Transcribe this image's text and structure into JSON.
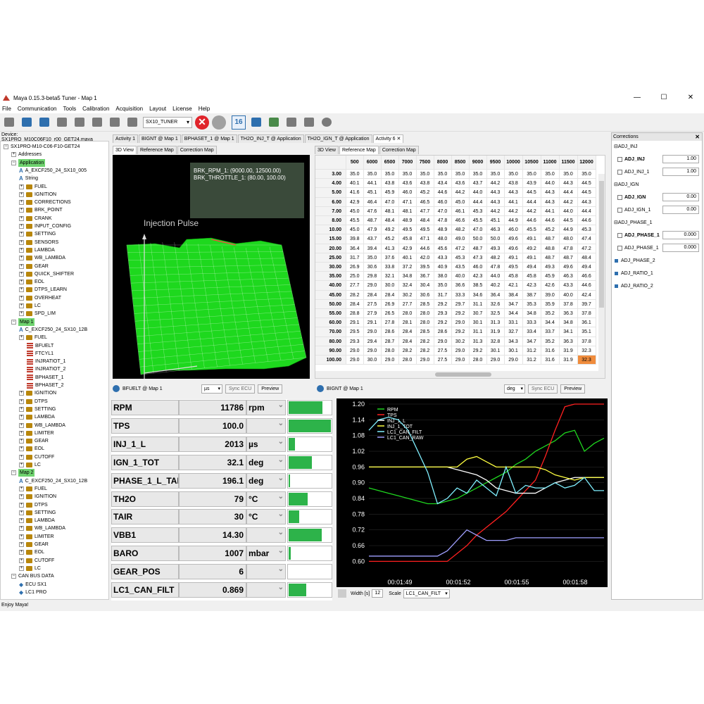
{
  "window": {
    "title": "Maya 0.15.3-beta5 Tuner - Map 1",
    "minimize": "—",
    "maximize": "☐",
    "close": "✕"
  },
  "menu": [
    "File",
    "Communication",
    "Tools",
    "Calibration",
    "Acquisition",
    "Layout",
    "License",
    "Help"
  ],
  "toolbar": {
    "tuner_select": "SX10_TUNER",
    "stop": "✕",
    "calendar_num": "16"
  },
  "device": "Device: SX1PRO_M10C06F10_r00_GET24.maya",
  "tree": [
    {
      "label": "SX1PRO-M10-C06-F10-GET24",
      "indent": 0,
      "kind": "exp",
      "exp": "−"
    },
    {
      "label": "Addresses",
      "indent": 1,
      "kind": "exp",
      "exp": "+"
    },
    {
      "label": "Application",
      "indent": 1,
      "kind": "exp",
      "exp": "−",
      "hl": true
    },
    {
      "label": "A_EXCF250_24_SX10_005",
      "indent": 2,
      "kind": "a"
    },
    {
      "label": "String",
      "indent": 2,
      "kind": "a"
    },
    {
      "label": "FUEL",
      "indent": 2,
      "kind": "f"
    },
    {
      "label": "IGNITION",
      "indent": 2,
      "kind": "f"
    },
    {
      "label": "CORRECTIONS",
      "indent": 2,
      "kind": "f"
    },
    {
      "label": "BRK_POINT",
      "indent": 2,
      "kind": "f"
    },
    {
      "label": "CRANK",
      "indent": 2,
      "kind": "f"
    },
    {
      "label": "INPUT_CONFIG",
      "indent": 2,
      "kind": "f"
    },
    {
      "label": "SETTING",
      "indent": 2,
      "kind": "f"
    },
    {
      "label": "SENSORS",
      "indent": 2,
      "kind": "f"
    },
    {
      "label": "LAMBDA",
      "indent": 2,
      "kind": "f"
    },
    {
      "label": "WB_LAMBDA",
      "indent": 2,
      "kind": "f"
    },
    {
      "label": "GEAR",
      "indent": 2,
      "kind": "f"
    },
    {
      "label": "QUICK_SHIFTER",
      "indent": 2,
      "kind": "f"
    },
    {
      "label": "EOL",
      "indent": 2,
      "kind": "f"
    },
    {
      "label": "DTPS_LEARN",
      "indent": 2,
      "kind": "f"
    },
    {
      "label": "OVERHEAT",
      "indent": 2,
      "kind": "f"
    },
    {
      "label": "LC",
      "indent": 2,
      "kind": "f"
    },
    {
      "label": "SPD_LIM",
      "indent": 2,
      "kind": "f"
    },
    {
      "label": "Map 1",
      "indent": 1,
      "kind": "exp",
      "exp": "−",
      "hl": true
    },
    {
      "label": "C_EXCF250_24_SX10_12B",
      "indent": 2,
      "kind": "a"
    },
    {
      "label": "FUEL",
      "indent": 2,
      "kind": "f"
    },
    {
      "label": "BFUELT",
      "indent": 3,
      "kind": "t"
    },
    {
      "label": "FTCYL1",
      "indent": 3,
      "kind": "t"
    },
    {
      "label": "INJRATIOT_1",
      "indent": 3,
      "kind": "t"
    },
    {
      "label": "INJRATIOT_2",
      "indent": 3,
      "kind": "t"
    },
    {
      "label": "BPHASET_1",
      "indent": 3,
      "kind": "t"
    },
    {
      "label": "BPHASET_2",
      "indent": 3,
      "kind": "t"
    },
    {
      "label": "IGNITION",
      "indent": 2,
      "kind": "f"
    },
    {
      "label": "DTPS",
      "indent": 2,
      "kind": "f"
    },
    {
      "label": "SETTING",
      "indent": 2,
      "kind": "f"
    },
    {
      "label": "LAMBDA",
      "indent": 2,
      "kind": "f"
    },
    {
      "label": "WB_LAMBDA",
      "indent": 2,
      "kind": "f"
    },
    {
      "label": "LIMITER",
      "indent": 2,
      "kind": "f"
    },
    {
      "label": "GEAR",
      "indent": 2,
      "kind": "f"
    },
    {
      "label": "EOL",
      "indent": 2,
      "kind": "f"
    },
    {
      "label": "CUTOFF",
      "indent": 2,
      "kind": "f"
    },
    {
      "label": "LC",
      "indent": 2,
      "kind": "f"
    },
    {
      "label": "Map 2",
      "indent": 1,
      "kind": "exp",
      "exp": "−",
      "hl": true
    },
    {
      "label": "C_EXCF250_24_SX10_12B",
      "indent": 2,
      "kind": "a"
    },
    {
      "label": "FUEL",
      "indent": 2,
      "kind": "f"
    },
    {
      "label": "IGNITION",
      "indent": 2,
      "kind": "f"
    },
    {
      "label": "DTPS",
      "indent": 2,
      "kind": "f"
    },
    {
      "label": "SETTING",
      "indent": 2,
      "kind": "f"
    },
    {
      "label": "LAMBDA",
      "indent": 2,
      "kind": "f"
    },
    {
      "label": "WB_LAMBDA",
      "indent": 2,
      "kind": "f"
    },
    {
      "label": "LIMITER",
      "indent": 2,
      "kind": "f"
    },
    {
      "label": "GEAR",
      "indent": 2,
      "kind": "f"
    },
    {
      "label": "EOL",
      "indent": 2,
      "kind": "f"
    },
    {
      "label": "CUTOFF",
      "indent": 2,
      "kind": "f"
    },
    {
      "label": "LC",
      "indent": 2,
      "kind": "f"
    },
    {
      "label": "CAN BUS DATA",
      "indent": 1,
      "kind": "exp",
      "exp": "−"
    },
    {
      "label": "ECU SX1",
      "indent": 2,
      "kind": "b"
    },
    {
      "label": "LC1 PRO",
      "indent": 2,
      "kind": "b"
    }
  ],
  "main_tabs": [
    "Activity 1",
    "BIGNT @ Map 1",
    "BPHASET_1 @ Map 1",
    "TH2O_INJ_T @ Application",
    "TH2O_IGN_T @ Application",
    "Activity 6"
  ],
  "main_tab_close": "✕",
  "left_view_tabs": [
    "3D View",
    "Reference Map",
    "Correction Map"
  ],
  "right_view_tabs": [
    "3D View",
    "Reference Map",
    "Correction Map"
  ],
  "view3d": {
    "title": "Injection Pulse",
    "info_line1": "BRK_RPM_1: (9000.00, 12500.00)",
    "info_line2": "BRK_THROTTLE_1: (80.00, 100.00)",
    "surface_color": "#1ed81e"
  },
  "map_table": {
    "cols": [
      "500",
      "6000",
      "6500",
      "7000",
      "7500",
      "8000",
      "8500",
      "9000",
      "9500",
      "10000",
      "10500",
      "11000",
      "11500",
      "12000"
    ],
    "rows": [
      "3.00",
      "4.00",
      "5.00",
      "6.00",
      "7.00",
      "8.00",
      "10.00",
      "15.00",
      "20.00",
      "25.00",
      "30.00",
      "35.00",
      "40.00",
      "45.00",
      "50.00",
      "55.00",
      "60.00",
      "70.00",
      "80.00",
      "90.00",
      "100.00"
    ],
    "values": [
      [
        "35.0",
        "35.0",
        "35.0",
        "35.0",
        "35.0",
        "35.0",
        "35.0",
        "35.0",
        "35.0",
        "35.0",
        "35.0",
        "35.0",
        "35.0",
        "35.0"
      ],
      [
        "40.1",
        "44.1",
        "43.8",
        "43.6",
        "43.8",
        "43.4",
        "43.6",
        "43.7",
        "44.2",
        "43.8",
        "43.9",
        "44.0",
        "44.3",
        "44.5"
      ],
      [
        "41.6",
        "45.1",
        "45.9",
        "46.0",
        "45.2",
        "44.6",
        "44.2",
        "44.0",
        "44.3",
        "44.3",
        "44.5",
        "44.3",
        "44.4",
        "44.5"
      ],
      [
        "42.9",
        "46.4",
        "47.0",
        "47.1",
        "46.5",
        "46.0",
        "45.0",
        "44.4",
        "44.3",
        "44.1",
        "44.4",
        "44.3",
        "44.2",
        "44.3"
      ],
      [
        "45.0",
        "47.6",
        "48.1",
        "48.1",
        "47.7",
        "47.0",
        "46.1",
        "45.3",
        "44.2",
        "44.2",
        "44.2",
        "44.1",
        "44.0",
        "44.4"
      ],
      [
        "45.5",
        "48.7",
        "48.4",
        "48.9",
        "48.4",
        "47.8",
        "46.6",
        "45.5",
        "45.1",
        "44.9",
        "44.6",
        "44.6",
        "44.5",
        "44.6"
      ],
      [
        "45.0",
        "47.9",
        "49.2",
        "49.5",
        "49.5",
        "48.9",
        "48.2",
        "47.0",
        "46.3",
        "46.0",
        "45.5",
        "45.2",
        "44.9",
        "45.3"
      ],
      [
        "39.8",
        "43.7",
        "45.2",
        "45.8",
        "47.1",
        "48.0",
        "49.0",
        "50.0",
        "50.0",
        "49.6",
        "49.1",
        "48.7",
        "48.0",
        "47.4"
      ],
      [
        "36.4",
        "39.4",
        "41.3",
        "42.9",
        "44.6",
        "45.6",
        "47.2",
        "48.7",
        "49.3",
        "49.6",
        "49.2",
        "48.8",
        "47.8",
        "47.2"
      ],
      [
        "31.7",
        "35.0",
        "37.6",
        "40.1",
        "42.0",
        "43.3",
        "45.3",
        "47.3",
        "48.2",
        "49.1",
        "49.1",
        "48.7",
        "48.7",
        "48.4"
      ],
      [
        "26.9",
        "30.6",
        "33.8",
        "37.2",
        "39.5",
        "40.9",
        "43.5",
        "46.0",
        "47.8",
        "49.5",
        "49.4",
        "49.3",
        "49.6",
        "49.4"
      ],
      [
        "25.0",
        "29.8",
        "32.1",
        "34.8",
        "36.7",
        "38.0",
        "40.0",
        "42.3",
        "44.0",
        "45.8",
        "45.8",
        "45.9",
        "46.3",
        "46.6"
      ],
      [
        "27.7",
        "29.0",
        "30.0",
        "32.4",
        "30.4",
        "35.0",
        "36.6",
        "38.5",
        "40.2",
        "42.1",
        "42.3",
        "42.6",
        "43.3",
        "44.6"
      ],
      [
        "28.2",
        "28.4",
        "28.4",
        "30.2",
        "30.6",
        "31.7",
        "33.3",
        "34.6",
        "36.4",
        "38.4",
        "38.7",
        "39.0",
        "40.0",
        "42.4"
      ],
      [
        "28.4",
        "27.5",
        "26.9",
        "27.7",
        "28.5",
        "29.2",
        "29.7",
        "31.1",
        "32.6",
        "34.7",
        "35.3",
        "35.9",
        "37.8",
        "39.7"
      ],
      [
        "28.8",
        "27.9",
        "26.5",
        "28.0",
        "28.0",
        "29.3",
        "29.2",
        "30.7",
        "32.5",
        "34.4",
        "34.8",
        "35.2",
        "36.3",
        "37.8"
      ],
      [
        "29.1",
        "29.1",
        "27.8",
        "28.1",
        "28.0",
        "29.2",
        "29.0",
        "30.1",
        "31.3",
        "33.1",
        "33.3",
        "34.4",
        "34.8",
        "36.1"
      ],
      [
        "29.5",
        "29.0",
        "28.6",
        "28.4",
        "28.5",
        "28.6",
        "29.2",
        "31.1",
        "31.9",
        "32.7",
        "33.4",
        "33.7",
        "34.1",
        "35.1"
      ],
      [
        "29.3",
        "29.4",
        "28.7",
        "28.4",
        "28.2",
        "29.0",
        "30.2",
        "31.3",
        "32.8",
        "34.3",
        "34.7",
        "35.2",
        "36.3",
        "37.8"
      ],
      [
        "29.0",
        "29.0",
        "28.0",
        "28.2",
        "28.2",
        "27.5",
        "29.0",
        "29.2",
        "30.1",
        "30.1",
        "31.2",
        "31.6",
        "31.9",
        "32.3"
      ],
      [
        "29.0",
        "30.0",
        "29.0",
        "28.0",
        "29.0",
        "27.5",
        "29.0",
        "28.0",
        "29.0",
        "29.0",
        "31.2",
        "31.6",
        "31.9",
        "32.3"
      ]
    ],
    "highlight_color": "#f08c3c"
  },
  "left_panel": {
    "title": "BFUELT @ Map 1",
    "unit_select": "µs",
    "sync": "Sync ECU",
    "preview": "Preview"
  },
  "right_panel": {
    "title": "BIGNT @ Map 1",
    "unit_select": "deg",
    "sync": "Sync ECU",
    "preview": "Preview"
  },
  "dashboard": [
    {
      "name": "RPM",
      "value": "11786",
      "unit": "rpm",
      "level": 0.8
    },
    {
      "name": "TPS",
      "value": "100.0",
      "unit": "",
      "level": 1.0
    },
    {
      "name": "INJ_1_L",
      "value": "2013",
      "unit": "µs",
      "level": 0.15
    },
    {
      "name": "IGN_1_TOT",
      "value": "32.1",
      "unit": "deg",
      "level": 0.55
    },
    {
      "name": "PHASE_1_L_TAB",
      "value": "196.1",
      "unit": "deg",
      "level": 0.03
    },
    {
      "name": "TH2O",
      "value": "79",
      "unit": "°C",
      "level": 0.45
    },
    {
      "name": "TAIR",
      "value": "30",
      "unit": "°C",
      "level": 0.25
    },
    {
      "name": "VBB1",
      "value": "14.30",
      "unit": "",
      "level": 0.78
    },
    {
      "name": "BARO",
      "value": "1007",
      "unit": "mbar",
      "level": 0.05
    },
    {
      "name": "GEAR_POS",
      "value": "6",
      "unit": "",
      "level": 0.0
    },
    {
      "name": "LC1_CAN_FILT",
      "value": "0.869",
      "unit": "",
      "level": 0.42
    }
  ],
  "bar_color": "#2db34a",
  "chart_data": {
    "type": "line",
    "ylim": [
      0.55,
      1.2
    ],
    "yticks": [
      "1.20",
      "1.14",
      "1.08",
      "1.02",
      "0.96",
      "0.90",
      "0.84",
      "0.78",
      "0.72",
      "0.66",
      "0.60"
    ],
    "xticks": [
      "00:01:49",
      "00:01:52",
      "00:01:55",
      "00:01:58"
    ],
    "x": [
      0,
      0.5,
      1,
      1.5,
      2,
      2.5,
      3,
      3.5,
      4,
      4.5,
      5,
      5.5,
      6,
      6.5,
      7,
      7.5,
      8,
      8.5,
      9,
      9.5,
      10,
      10.5,
      11,
      11.5,
      12
    ],
    "series": [
      {
        "name": "RPM",
        "color": "#1fd61f",
        "values": [
          0.88,
          0.87,
          0.86,
          0.85,
          0.84,
          0.83,
          0.82,
          0.82,
          0.83,
          0.84,
          0.86,
          0.88,
          0.9,
          0.92,
          0.94,
          0.97,
          0.99,
          1.02,
          1.04,
          1.06,
          1.09,
          1.1,
          1.02,
          1.05,
          1.07
        ]
      },
      {
        "name": "TPS",
        "color": "#ff2020",
        "values": [
          0.6,
          0.6,
          0.6,
          0.6,
          0.6,
          0.6,
          0.6,
          0.6,
          0.6,
          0.63,
          0.66,
          0.7,
          0.73,
          0.76,
          0.79,
          0.83,
          0.87,
          0.91,
          1.0,
          1.1,
          1.19,
          1.2,
          1.2,
          1.2,
          1.2
        ]
      },
      {
        "name": "INJ_1_L",
        "color": "#ffffff",
        "values": [
          0.96,
          0.96,
          0.96,
          0.96,
          0.96,
          0.96,
          0.96,
          0.96,
          0.96,
          0.95,
          0.94,
          0.93,
          0.91,
          0.88,
          0.87,
          0.86,
          0.86,
          0.86,
          0.88,
          0.9,
          0.91,
          0.92,
          0.92,
          0.92,
          0.92
        ]
      },
      {
        "name": "INJ_1_TOT",
        "color": "#ffff40",
        "values": [
          0.96,
          0.96,
          0.96,
          0.96,
          0.96,
          0.96,
          0.96,
          0.96,
          0.96,
          0.96,
          0.99,
          1.0,
          0.98,
          0.96,
          0.96,
          0.96,
          0.96,
          0.96,
          0.95,
          0.93,
          0.92,
          0.91,
          0.92,
          0.92,
          0.92
        ]
      },
      {
        "name": "LC1_CAN_FILT",
        "color": "#80f0ff",
        "values": [
          1.1,
          1.14,
          1.15,
          1.14,
          1.1,
          1.02,
          0.94,
          0.82,
          0.84,
          0.88,
          0.86,
          0.91,
          0.88,
          0.85,
          0.96,
          0.86,
          0.89,
          0.88,
          0.88,
          0.9,
          0.88,
          0.89,
          0.92,
          0.87,
          0.87
        ]
      },
      {
        "name": "LC1_CAN_RAW",
        "color": "#a0a0ff",
        "values": [
          0.62,
          0.62,
          0.62,
          0.62,
          0.62,
          0.62,
          0.62,
          0.62,
          0.64,
          0.68,
          0.72,
          0.7,
          0.68,
          0.68,
          0.68,
          0.69,
          0.69,
          0.69,
          0.69,
          0.69,
          0.69,
          0.69,
          0.69,
          0.69,
          0.69
        ]
      }
    ]
  },
  "chart_foot": {
    "width_label": "Width [s]",
    "width_value": "12",
    "scale_label": "Scale",
    "scale_value": "LC1_CAN_FILT"
  },
  "corrections": {
    "title": "Corrections",
    "close": "✕",
    "rows": [
      {
        "label": "ADJ_INJ",
        "kind": "group"
      },
      {
        "label": "ADJ_INJ",
        "kind": "item",
        "bold": true,
        "value": "1.00"
      },
      {
        "label": "ADJ_INJ_1",
        "kind": "item",
        "value": "1.00"
      },
      {
        "label": "ADJ_IGN",
        "kind": "group"
      },
      {
        "label": "ADJ_IGN",
        "kind": "item",
        "bold": true,
        "value": "0.00"
      },
      {
        "label": "ADJ_IGN_1",
        "kind": "item",
        "value": "0.00"
      },
      {
        "label": "ADJ_PHASE_1",
        "kind": "group"
      },
      {
        "label": "ADJ_PHASE_1",
        "kind": "item",
        "bold": true,
        "value": "0.000"
      },
      {
        "label": "ADJ_PHASE_1",
        "kind": "item",
        "value": "0.000"
      },
      {
        "label": "ADJ_PHASE_2",
        "kind": "sq"
      },
      {
        "label": "ADJ_RATIO_1",
        "kind": "sq"
      },
      {
        "label": "ADJ_RATIO_2",
        "kind": "sq"
      }
    ]
  },
  "status": "Enjoy Maya!"
}
